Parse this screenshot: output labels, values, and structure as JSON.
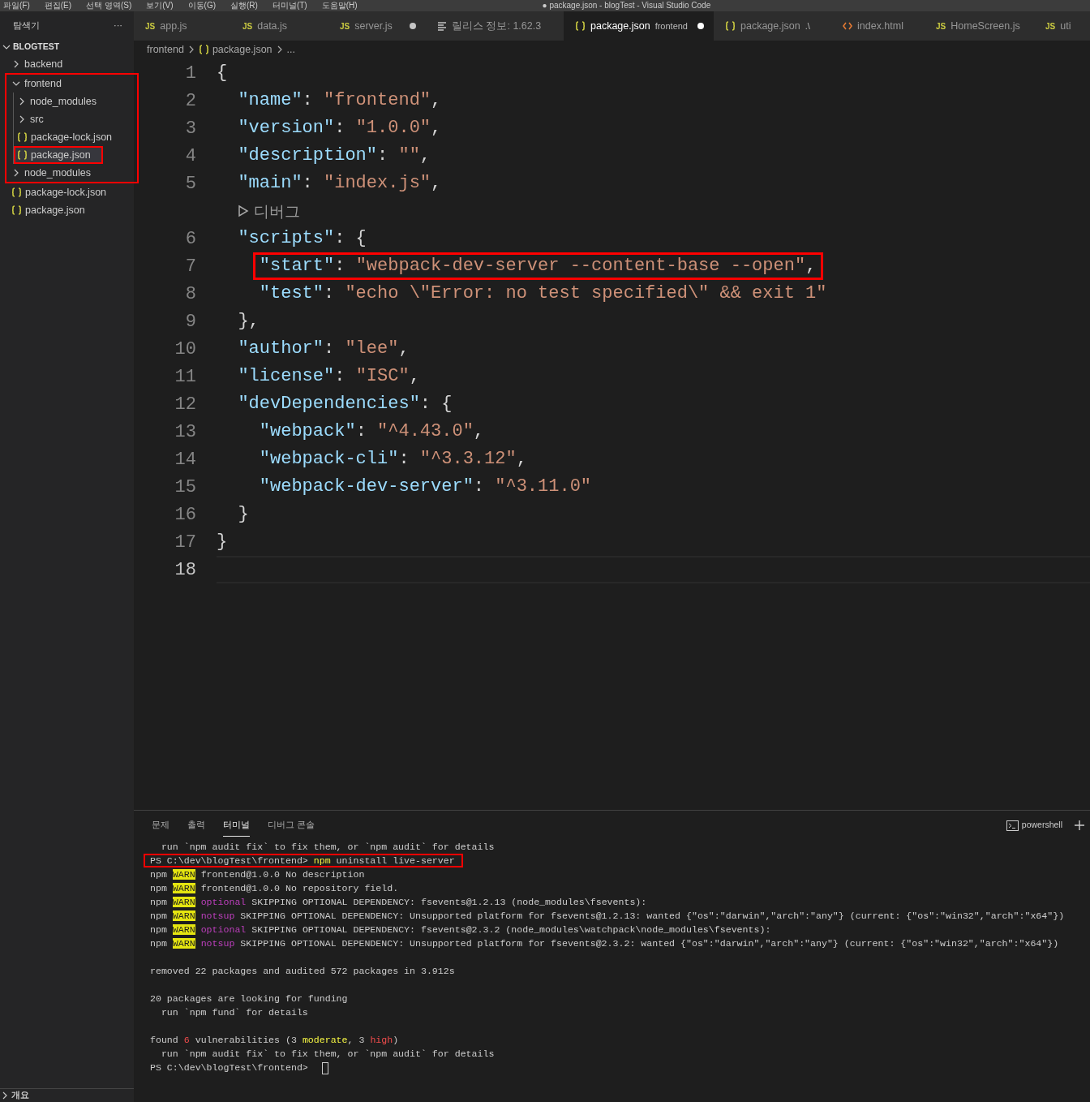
{
  "window": {
    "menu": [
      "파일(F)",
      "편집(E)",
      "선택 영역(S)",
      "보기(V)",
      "이동(G)",
      "실행(R)",
      "터미널(T)",
      "도움말(H)"
    ],
    "title": "● package.json - blogTest - Visual Studio Code"
  },
  "explorer": {
    "title": "탐색기",
    "more": "···",
    "root": "BLOGTEST",
    "root_expanded": true,
    "tree": [
      {
        "kind": "folder",
        "label": "backend",
        "expanded": false,
        "selected": false,
        "boxed": false
      },
      {
        "kind": "annotation_box",
        "items": [
          {
            "kind": "folder",
            "label": "frontend",
            "expanded": true,
            "selected": false,
            "boxed": false,
            "children": [
              {
                "kind": "folder",
                "label": "node_modules",
                "expanded": false,
                "selected": false,
                "boxed": false
              },
              {
                "kind": "folder",
                "label": "src",
                "expanded": false,
                "selected": false,
                "boxed": false
              },
              {
                "kind": "file",
                "label": "package-lock.json",
                "selected": false,
                "boxed": false
              },
              {
                "kind": "file",
                "label": "package.json",
                "selected": true,
                "boxed": true
              }
            ]
          },
          {
            "kind": "folder",
            "label": "node_modules",
            "expanded": false,
            "selected": false,
            "boxed": false
          }
        ]
      },
      {
        "kind": "file",
        "label": "package-lock.json",
        "selected": false,
        "boxed": false
      },
      {
        "kind": "file",
        "label": "package.json",
        "selected": false,
        "boxed": false
      }
    ],
    "outline": {
      "label": "개요",
      "expanded": false
    }
  },
  "tabs": [
    {
      "kind": "js",
      "badge": "JS",
      "label": "app.js",
      "selected": false,
      "dirty": false
    },
    {
      "kind": "js",
      "badge": "JS",
      "label": "data.js",
      "selected": false,
      "dirty": false
    },
    {
      "kind": "js",
      "badge": "JS",
      "label": "server.js",
      "selected": false,
      "dirty": true
    },
    {
      "kind": "info",
      "label": "릴리스 정보: 1.62.3",
      "selected": false,
      "dirty": false
    },
    {
      "kind": "json",
      "label": "package.json",
      "description": "frontend",
      "selected": true,
      "dirty": true
    },
    {
      "kind": "json",
      "label": "package.json",
      "description": ".\\",
      "selected": false,
      "dirty": false
    },
    {
      "kind": "html",
      "label": "index.html",
      "selected": false,
      "dirty": false
    },
    {
      "kind": "js",
      "badge": "JS",
      "label": "HomeScreen.js",
      "selected": false,
      "dirty": false
    },
    {
      "kind": "js",
      "badge": "JS",
      "label": "uti",
      "selected": false,
      "dirty": false
    }
  ],
  "breadcrumb": [
    {
      "kind": "folder",
      "label": "frontend"
    },
    {
      "kind": "json",
      "label": "package.json"
    },
    {
      "kind": "more",
      "label": "..."
    }
  ],
  "editor": {
    "lines": [
      {
        "kind": "code",
        "number": "1",
        "current": false,
        "boxed": false,
        "tokens": [
          {
            "kind": "punct",
            "text": "{"
          }
        ],
        "children": [
          {
            "kind": "code",
            "number": "2",
            "current": false,
            "boxed": false,
            "tokens": [
              {
                "kind": "key",
                "text": "\"name\""
              },
              {
                "kind": "punct",
                "text": ": "
              },
              {
                "kind": "string",
                "text": "\"frontend\""
              },
              {
                "kind": "punct",
                "text": ","
              }
            ]
          },
          {
            "kind": "code",
            "number": "3",
            "current": false,
            "boxed": false,
            "tokens": [
              {
                "kind": "key",
                "text": "\"version\""
              },
              {
                "kind": "punct",
                "text": ": "
              },
              {
                "kind": "string",
                "text": "\"1.0.0\""
              },
              {
                "kind": "punct",
                "text": ","
              }
            ]
          },
          {
            "kind": "code",
            "number": "4",
            "current": false,
            "boxed": false,
            "tokens": [
              {
                "kind": "key",
                "text": "\"description\""
              },
              {
                "kind": "punct",
                "text": ": "
              },
              {
                "kind": "string",
                "text": "\"\""
              },
              {
                "kind": "punct",
                "text": ","
              }
            ]
          },
          {
            "kind": "code",
            "number": "5",
            "current": false,
            "boxed": false,
            "tokens": [
              {
                "kind": "key",
                "text": "\"main\""
              },
              {
                "kind": "punct",
                "text": ": "
              },
              {
                "kind": "string",
                "text": "\"index.js\""
              },
              {
                "kind": "punct",
                "text": ","
              }
            ]
          },
          {
            "kind": "codelens",
            "text": "디버그"
          },
          {
            "kind": "code",
            "number": "6",
            "current": false,
            "boxed": false,
            "tokens": [
              {
                "kind": "key",
                "text": "\"scripts\""
              },
              {
                "kind": "punct",
                "text": ": {"
              }
            ],
            "children": [
              {
                "kind": "code",
                "number": "7",
                "current": false,
                "boxed": true,
                "tokens": [
                  {
                    "kind": "key",
                    "text": "\"start\""
                  },
                  {
                    "kind": "punct",
                    "text": ": "
                  },
                  {
                    "kind": "string",
                    "text": "\"webpack-dev-server --content-base --open\""
                  },
                  {
                    "kind": "punct",
                    "text": ","
                  }
                ]
              },
              {
                "kind": "code",
                "number": "8",
                "current": false,
                "boxed": false,
                "tokens": [
                  {
                    "kind": "key",
                    "text": "\"test\""
                  },
                  {
                    "kind": "punct",
                    "text": ": "
                  },
                  {
                    "kind": "string",
                    "text": "\"echo \\\"Error: no test specified\\\" && exit 1\""
                  }
                ]
              }
            ]
          },
          {
            "kind": "code",
            "number": "9",
            "current": false,
            "boxed": false,
            "tokens": [
              {
                "kind": "punct",
                "text": "},"
              }
            ]
          },
          {
            "kind": "code",
            "number": "10",
            "current": false,
            "boxed": false,
            "tokens": [
              {
                "kind": "key",
                "text": "\"author\""
              },
              {
                "kind": "punct",
                "text": ": "
              },
              {
                "kind": "string",
                "text": "\"lee\""
              },
              {
                "kind": "punct",
                "text": ","
              }
            ]
          },
          {
            "kind": "code",
            "number": "11",
            "current": false,
            "boxed": false,
            "tokens": [
              {
                "kind": "key",
                "text": "\"license\""
              },
              {
                "kind": "punct",
                "text": ": "
              },
              {
                "kind": "string",
                "text": "\"ISC\""
              },
              {
                "kind": "punct",
                "text": ","
              }
            ]
          },
          {
            "kind": "code",
            "number": "12",
            "current": false,
            "boxed": false,
            "tokens": [
              {
                "kind": "key",
                "text": "\"devDependencies\""
              },
              {
                "kind": "punct",
                "text": ": {"
              }
            ],
            "children": [
              {
                "kind": "code",
                "number": "13",
                "current": false,
                "boxed": false,
                "tokens": [
                  {
                    "kind": "key",
                    "text": "\"webpack\""
                  },
                  {
                    "kind": "punct",
                    "text": ": "
                  },
                  {
                    "kind": "string",
                    "text": "\"^4.43.0\""
                  },
                  {
                    "kind": "punct",
                    "text": ","
                  }
                ]
              },
              {
                "kind": "code",
                "number": "14",
                "current": false,
                "boxed": false,
                "tokens": [
                  {
                    "kind": "key",
                    "text": "\"webpack-cli\""
                  },
                  {
                    "kind": "punct",
                    "text": ": "
                  },
                  {
                    "kind": "string",
                    "text": "\"^3.3.12\""
                  },
                  {
                    "kind": "punct",
                    "text": ","
                  }
                ]
              },
              {
                "kind": "code",
                "number": "15",
                "current": false,
                "boxed": false,
                "tokens": [
                  {
                    "kind": "key",
                    "text": "\"webpack-dev-server\""
                  },
                  {
                    "kind": "punct",
                    "text": ": "
                  },
                  {
                    "kind": "string",
                    "text": "\"^3.11.0\""
                  }
                ]
              }
            ]
          },
          {
            "kind": "code",
            "number": "16",
            "current": false,
            "boxed": false,
            "tokens": [
              {
                "kind": "punct",
                "text": "}"
              }
            ]
          }
        ]
      },
      {
        "kind": "code",
        "number": "17",
        "current": false,
        "boxed": false,
        "tokens": [
          {
            "kind": "punct",
            "text": "}"
          }
        ]
      },
      {
        "kind": "code",
        "number": "18",
        "current": true,
        "boxed": false
      }
    ]
  },
  "panel": {
    "tabs": [
      {
        "label": "문제",
        "selected": false
      },
      {
        "label": "출력",
        "selected": false
      },
      {
        "label": "터미널",
        "selected": true
      },
      {
        "label": "디버그 콘솔",
        "selected": false
      }
    ],
    "shell": "powershell",
    "terminal": [
      {
        "kind": "text",
        "boxed": false,
        "cursor": false,
        "segments": [
          {
            "kind": "plain",
            "text": "  run `npm audit fix` to fix them, or `npm audit` for details"
          }
        ]
      },
      {
        "kind": "text",
        "boxed": true,
        "cursor": false,
        "segments": [
          {
            "kind": "plain",
            "text": "PS C:\\dev\\blogTest\\frontend> "
          },
          {
            "kind": "command",
            "text": "npm"
          },
          {
            "kind": "plain",
            "text": " uninstall live-server"
          }
        ]
      },
      {
        "kind": "text",
        "boxed": false,
        "cursor": false,
        "segments": [
          {
            "kind": "plain",
            "text": "npm "
          },
          {
            "kind": "warn",
            "text": "WARN"
          },
          {
            "kind": "plain",
            "text": " frontend@1.0.0 No description"
          }
        ]
      },
      {
        "kind": "text",
        "boxed": false,
        "cursor": false,
        "segments": [
          {
            "kind": "plain",
            "text": "npm "
          },
          {
            "kind": "warn",
            "text": "WARN"
          },
          {
            "kind": "plain",
            "text": " frontend@1.0.0 No repository field."
          }
        ]
      },
      {
        "kind": "text",
        "boxed": false,
        "cursor": false,
        "segments": [
          {
            "kind": "plain",
            "text": "npm "
          },
          {
            "kind": "warn",
            "text": "WARN"
          },
          {
            "kind": "tag",
            "text": " optional"
          },
          {
            "kind": "plain",
            "text": " SKIPPING OPTIONAL DEPENDENCY: fsevents@1.2.13 (node_modules\\fsevents):"
          }
        ]
      },
      {
        "kind": "text",
        "boxed": false,
        "cursor": false,
        "segments": [
          {
            "kind": "plain",
            "text": "npm "
          },
          {
            "kind": "warn",
            "text": "WARN"
          },
          {
            "kind": "tag",
            "text": " notsup"
          },
          {
            "kind": "plain",
            "text": " SKIPPING OPTIONAL DEPENDENCY: Unsupported platform for fsevents@1.2.13: wanted {\"os\":\"darwin\",\"arch\":\"any\"} (current: {\"os\":\"win32\",\"arch\":\"x64\"})"
          }
        ]
      },
      {
        "kind": "text",
        "boxed": false,
        "cursor": false,
        "segments": [
          {
            "kind": "plain",
            "text": "npm "
          },
          {
            "kind": "warn",
            "text": "WARN"
          },
          {
            "kind": "tag",
            "text": " optional"
          },
          {
            "kind": "plain",
            "text": " SKIPPING OPTIONAL DEPENDENCY: fsevents@2.3.2 (node_modules\\watchpack\\node_modules\\fsevents):"
          }
        ]
      },
      {
        "kind": "text",
        "boxed": false,
        "cursor": false,
        "segments": [
          {
            "kind": "plain",
            "text": "npm "
          },
          {
            "kind": "warn",
            "text": "WARN"
          },
          {
            "kind": "tag",
            "text": " notsup"
          },
          {
            "kind": "plain",
            "text": " SKIPPING OPTIONAL DEPENDENCY: Unsupported platform for fsevents@2.3.2: wanted {\"os\":\"darwin\",\"arch\":\"any\"} (current: {\"os\":\"win32\",\"arch\":\"x64\"})"
          }
        ]
      },
      {
        "kind": "blank"
      },
      {
        "kind": "text",
        "boxed": false,
        "cursor": false,
        "segments": [
          {
            "kind": "plain",
            "text": "removed 22 packages and audited 572 packages in 3.912s"
          }
        ]
      },
      {
        "kind": "blank"
      },
      {
        "kind": "text",
        "boxed": false,
        "cursor": false,
        "segments": [
          {
            "kind": "plain",
            "text": "20 packages are looking for funding"
          }
        ]
      },
      {
        "kind": "text",
        "boxed": false,
        "cursor": false,
        "segments": [
          {
            "kind": "plain",
            "text": "  run `npm fund` for details"
          }
        ]
      },
      {
        "kind": "blank"
      },
      {
        "kind": "text",
        "boxed": false,
        "cursor": false,
        "segments": [
          {
            "kind": "plain",
            "text": "found "
          },
          {
            "kind": "danger",
            "text": "6"
          },
          {
            "kind": "plain",
            "text": " vulnerabilities (3 "
          },
          {
            "kind": "warning",
            "text": "moderate"
          },
          {
            "kind": "plain",
            "text": ", 3 "
          },
          {
            "kind": "danger",
            "text": "high"
          },
          {
            "kind": "plain",
            "text": ")"
          }
        ]
      },
      {
        "kind": "text",
        "boxed": false,
        "cursor": false,
        "segments": [
          {
            "kind": "plain",
            "text": "  run `npm audit fix` to fix them, or `npm audit` for details"
          }
        ]
      },
      {
        "kind": "text",
        "boxed": false,
        "cursor": true,
        "segments": [
          {
            "kind": "plain",
            "text": "PS C:\\dev\\blogTest\\frontend> "
          }
        ]
      }
    ]
  }
}
